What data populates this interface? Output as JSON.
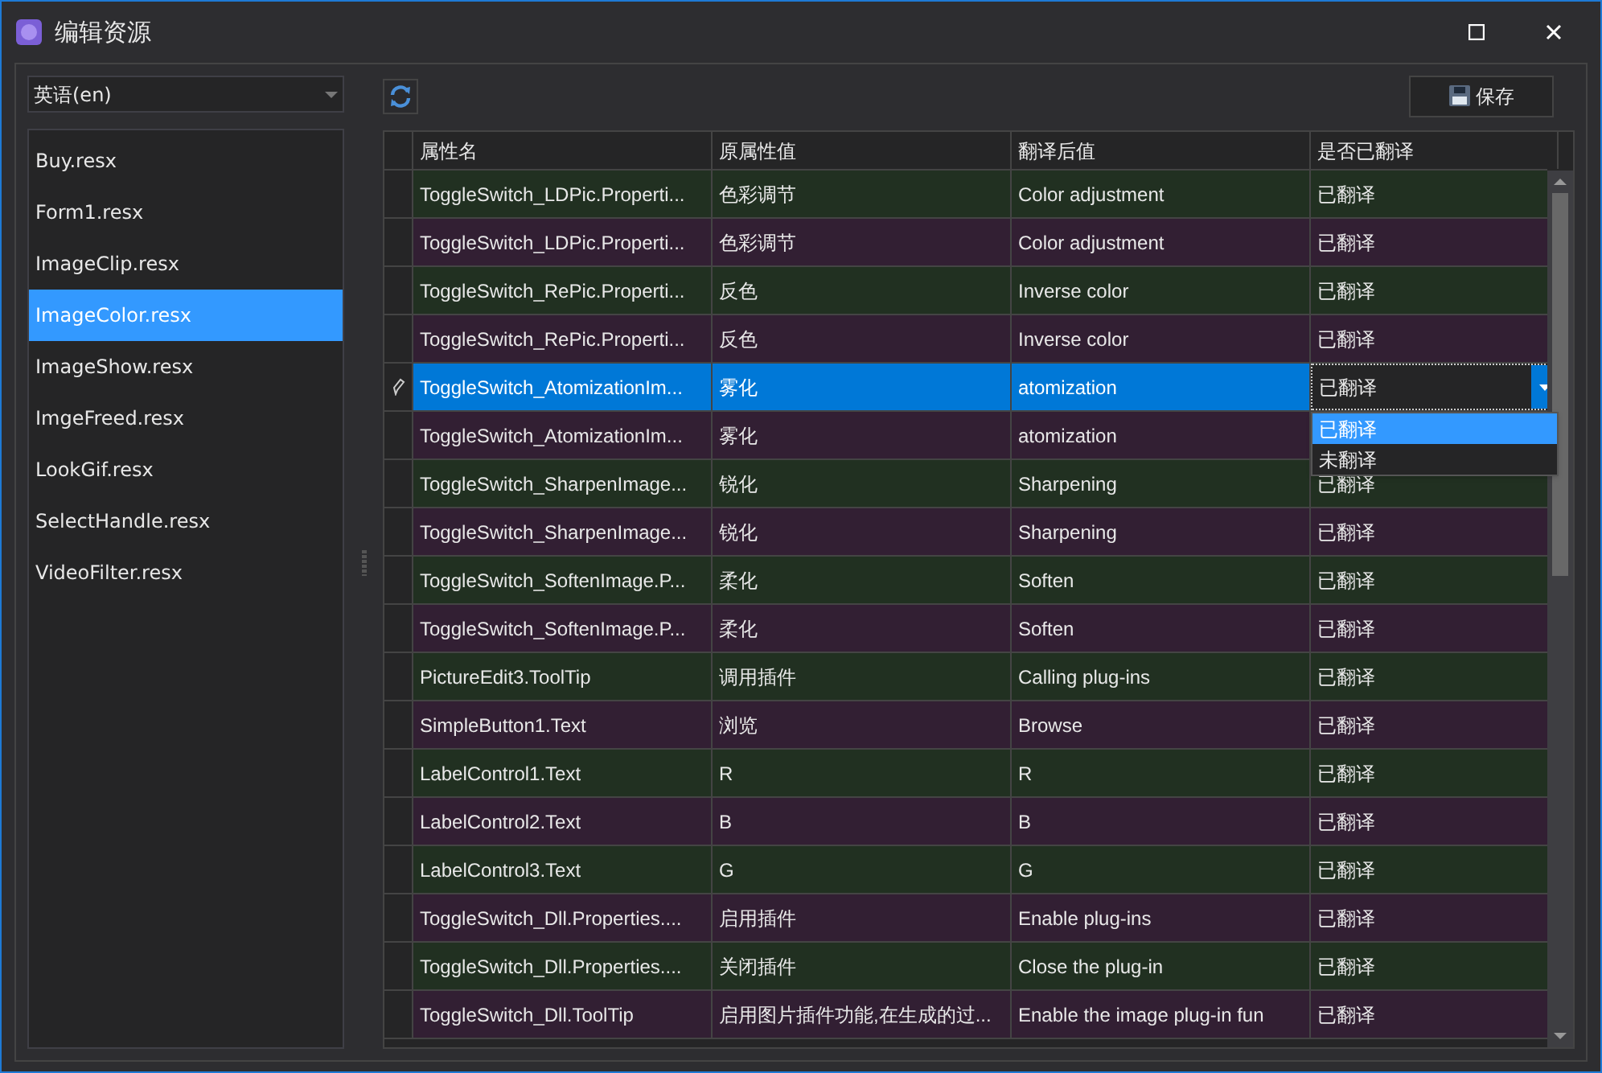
{
  "window": {
    "title": "编辑资源"
  },
  "language": {
    "value": "英语(en)"
  },
  "files": [
    {
      "label": "Buy.resx",
      "selected": false
    },
    {
      "label": "Form1.resx",
      "selected": false
    },
    {
      "label": "ImageClip.resx",
      "selected": false
    },
    {
      "label": "ImageColor.resx",
      "selected": true
    },
    {
      "label": "ImageShow.resx",
      "selected": false
    },
    {
      "label": "ImgeFreed.resx",
      "selected": false
    },
    {
      "label": "LookGif.resx",
      "selected": false
    },
    {
      "label": "SelectHandle.resx",
      "selected": false
    },
    {
      "label": "VideoFilter.resx",
      "selected": false
    }
  ],
  "save_button": {
    "label": "保存"
  },
  "table": {
    "columns": [
      "属性名",
      "原属性值",
      "翻译后值",
      "是否已翻译"
    ],
    "rows": [
      {
        "name": "ToggleSwitch_LDPic.Properti...",
        "original": "色彩调节",
        "translated": "Color adjustment",
        "status": "已翻译",
        "selected": false
      },
      {
        "name": "ToggleSwitch_LDPic.Properti...",
        "original": "色彩调节",
        "translated": "Color adjustment",
        "status": "已翻译",
        "selected": false
      },
      {
        "name": "ToggleSwitch_RePic.Properti...",
        "original": "反色",
        "translated": "Inverse color",
        "status": "已翻译",
        "selected": false
      },
      {
        "name": "ToggleSwitch_RePic.Properti...",
        "original": "反色",
        "translated": "Inverse color",
        "status": "已翻译",
        "selected": false
      },
      {
        "name": "ToggleSwitch_AtomizationIm...",
        "original": "雾化",
        "translated": "atomization",
        "status": "已翻译",
        "selected": true
      },
      {
        "name": "ToggleSwitch_AtomizationIm...",
        "original": "雾化",
        "translated": "atomization",
        "selected": false
      },
      {
        "name": "ToggleSwitch_SharpenImage...",
        "original": "锐化",
        "translated": "Sharpening",
        "status": "已翻译",
        "selected": false
      },
      {
        "name": "ToggleSwitch_SharpenImage...",
        "original": "锐化",
        "translated": "Sharpening",
        "status": "已翻译",
        "selected": false
      },
      {
        "name": "ToggleSwitch_SoftenImage.P...",
        "original": "柔化",
        "translated": "Soften",
        "status": "已翻译",
        "selected": false
      },
      {
        "name": "ToggleSwitch_SoftenImage.P...",
        "original": "柔化",
        "translated": "Soften",
        "status": "已翻译",
        "selected": false
      },
      {
        "name": "PictureEdit3.ToolTip",
        "original": "调用插件",
        "translated": "Calling plug-ins",
        "status": "已翻译",
        "selected": false
      },
      {
        "name": "SimpleButton1.Text",
        "original": "浏览",
        "translated": "Browse",
        "status": "已翻译",
        "selected": false
      },
      {
        "name": "LabelControl1.Text",
        "original": "R",
        "translated": "R",
        "status": "已翻译",
        "selected": false
      },
      {
        "name": "LabelControl2.Text",
        "original": "B",
        "translated": "B",
        "status": "已翻译",
        "selected": false
      },
      {
        "name": "LabelControl3.Text",
        "original": "G",
        "translated": "G",
        "status": "已翻译",
        "selected": false
      },
      {
        "name": "ToggleSwitch_Dll.Properties....",
        "original": "启用插件",
        "translated": "Enable plug-ins",
        "status": "已翻译",
        "selected": false
      },
      {
        "name": "ToggleSwitch_Dll.Properties....",
        "original": "关闭插件",
        "translated": "Close the plug-in",
        "status": "已翻译",
        "selected": false
      },
      {
        "name": "ToggleSwitch_Dll.ToolTip",
        "original": "启用图片插件功能,在生成的过...",
        "translated": "Enable the image plug-in fun",
        "status": "已翻译",
        "selected": false
      }
    ],
    "editor_options": [
      {
        "label": "已翻译",
        "selected": true
      },
      {
        "label": "未翻译",
        "selected": false
      }
    ]
  }
}
